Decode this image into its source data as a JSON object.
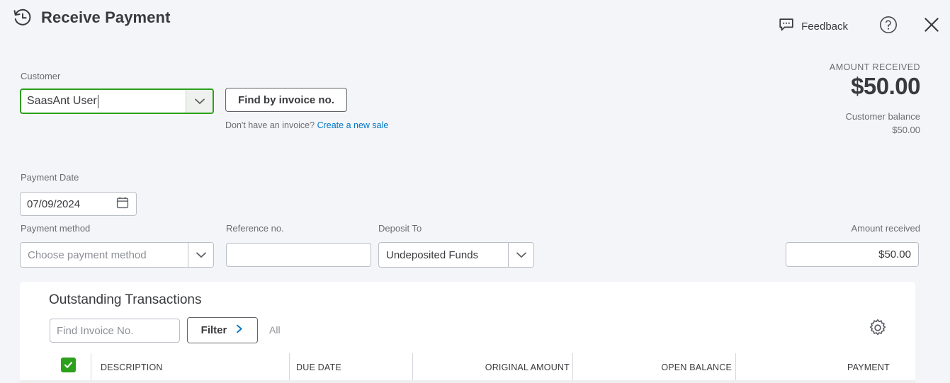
{
  "header": {
    "title": "Receive Payment",
    "history_icon": "history-clock-icon",
    "feedback_label": "Feedback",
    "feedback_icon": "speech-bubble-icon",
    "help_icon": "question-circle-icon",
    "close_icon": "close-x-icon"
  },
  "customer": {
    "label": "Customer",
    "value": "SaasAnt User",
    "dropdown_icon": "chevron-down-icon",
    "focused": true,
    "focus_color": "#2ca01c"
  },
  "find_invoice": {
    "button_label": "Find by invoice no.",
    "hint_text": "Don't have an invoice?",
    "link_label": "Create a new sale",
    "link_color": "#0077c5"
  },
  "summary": {
    "amount_received_caption": "AMOUNT RECEIVED",
    "amount_received_value": "$50.00",
    "customer_balance_caption": "Customer balance",
    "customer_balance_value": "$50.00"
  },
  "payment_date": {
    "label": "Payment Date",
    "value": "07/09/2024",
    "calendar_icon": "calendar-icon"
  },
  "payment_method": {
    "label": "Payment method",
    "placeholder": "Choose payment method",
    "value": "",
    "dropdown_icon": "chevron-down-icon"
  },
  "reference_no": {
    "label": "Reference no.",
    "value": "",
    "placeholder": ""
  },
  "deposit_to": {
    "label": "Deposit To",
    "value": "Undeposited Funds",
    "dropdown_icon": "chevron-down-icon"
  },
  "amount_received_field": {
    "label": "Amount received",
    "value": "$50.00"
  },
  "outstanding": {
    "title": "Outstanding Transactions",
    "search_placeholder": "Find Invoice No.",
    "search_value": "",
    "filter_label": "Filter",
    "filter_icon": "chevron-right-icon",
    "filter_summary": "All",
    "gear_icon": "gear-icon",
    "select_all_checked": true,
    "select_all_color": "#2ca01c",
    "columns": [
      {
        "key": "checkbox",
        "label": ""
      },
      {
        "key": "description",
        "label": "DESCRIPTION"
      },
      {
        "key": "due_date",
        "label": "DUE DATE"
      },
      {
        "key": "original_amount",
        "label": "ORIGINAL AMOUNT"
      },
      {
        "key": "open_balance",
        "label": "OPEN BALANCE"
      },
      {
        "key": "payment",
        "label": "PAYMENT"
      }
    ],
    "rows": []
  },
  "theme": {
    "page_background": "#f4f5f8",
    "panel_background": "#ffffff",
    "text_primary": "#393a3d",
    "text_secondary": "#6b6c72",
    "border": "#babec5",
    "accent_green": "#2ca01c",
    "accent_blue": "#0077c5"
  }
}
